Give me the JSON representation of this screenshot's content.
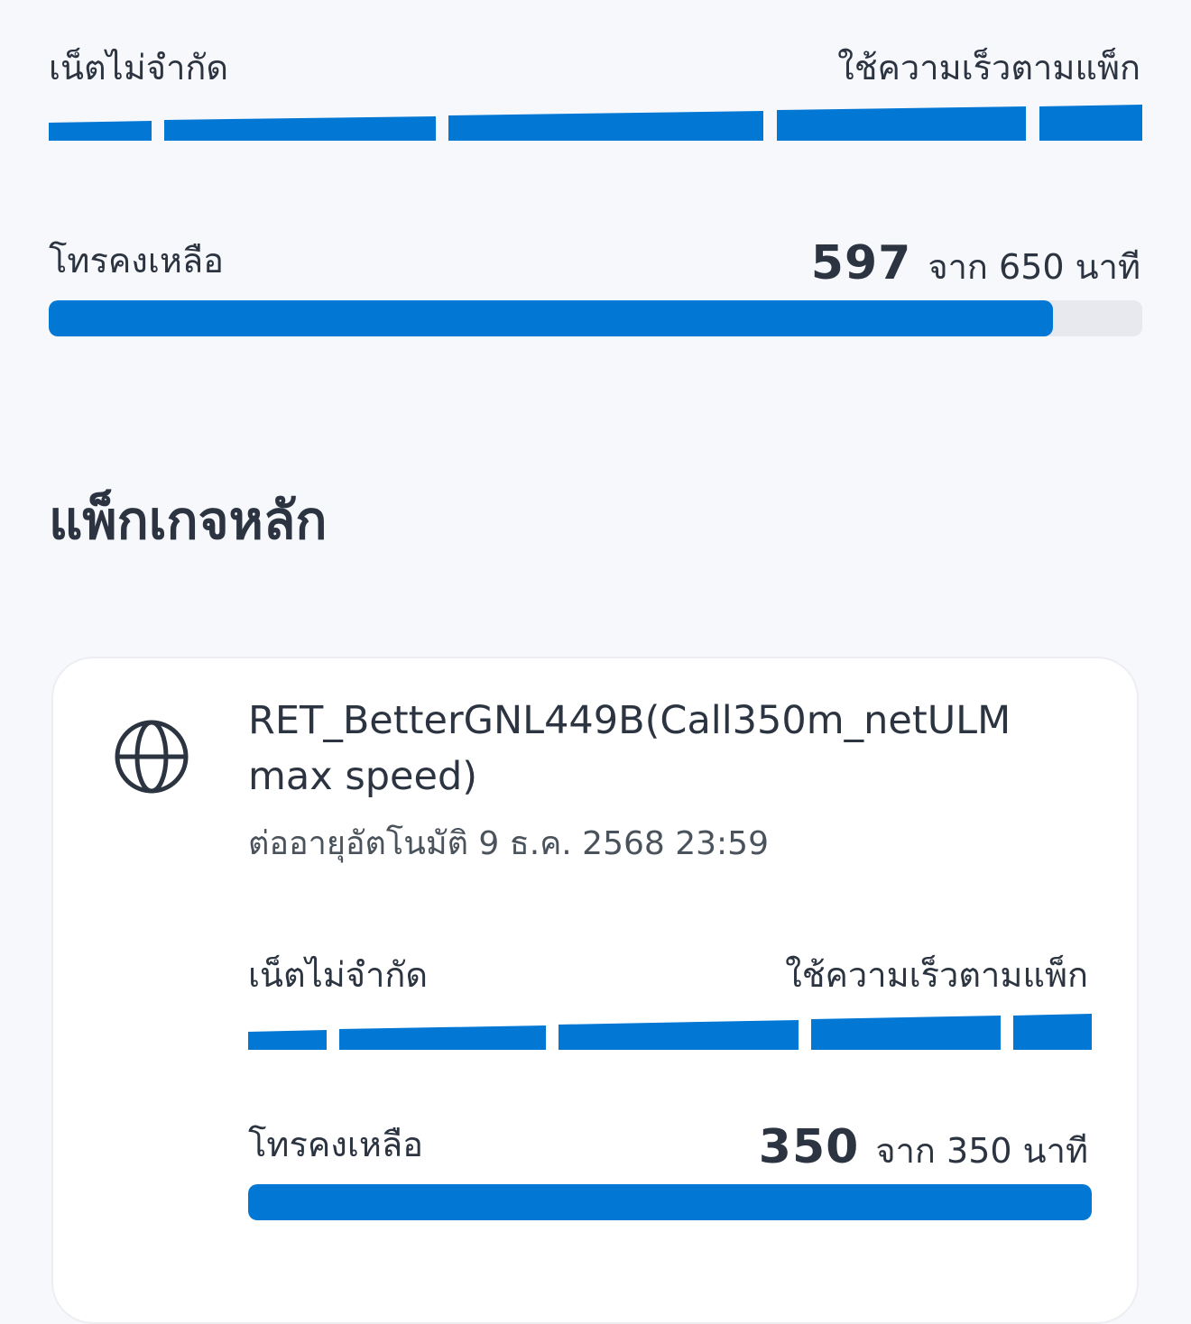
{
  "summary": {
    "data": {
      "label": "เน็ตไม่จำกัด",
      "speed_label": "ใช้ความเร็วตามแพ็ก"
    },
    "voice": {
      "label": "โทรคงเหลือ",
      "remaining": "597",
      "total_text": "จาก 650 นาที",
      "remaining_fraction": 0.918
    }
  },
  "main_package": {
    "title": "แพ็กเกจหลัก",
    "icon": "globe-icon",
    "name": "RET_BetterGNL449B(Call350m_netULM max speed)",
    "renewal_text": "ต่ออายุอัตโนมัติ 9 ธ.ค. 2568 23:59",
    "data": {
      "label": "เน็ตไม่จำกัด",
      "speed_label": "ใช้ความเร็วตามแพ็ก"
    },
    "voice": {
      "label": "โทรคงเหลือ",
      "remaining": "350",
      "total_text": "จาก 350 นาที",
      "remaining_fraction": 1.0
    }
  },
  "colors": {
    "accent": "#0277d4",
    "track": "#e7e9ee",
    "text": "#2b3440",
    "background": "#f7f8fc",
    "card": "#ffffff"
  }
}
